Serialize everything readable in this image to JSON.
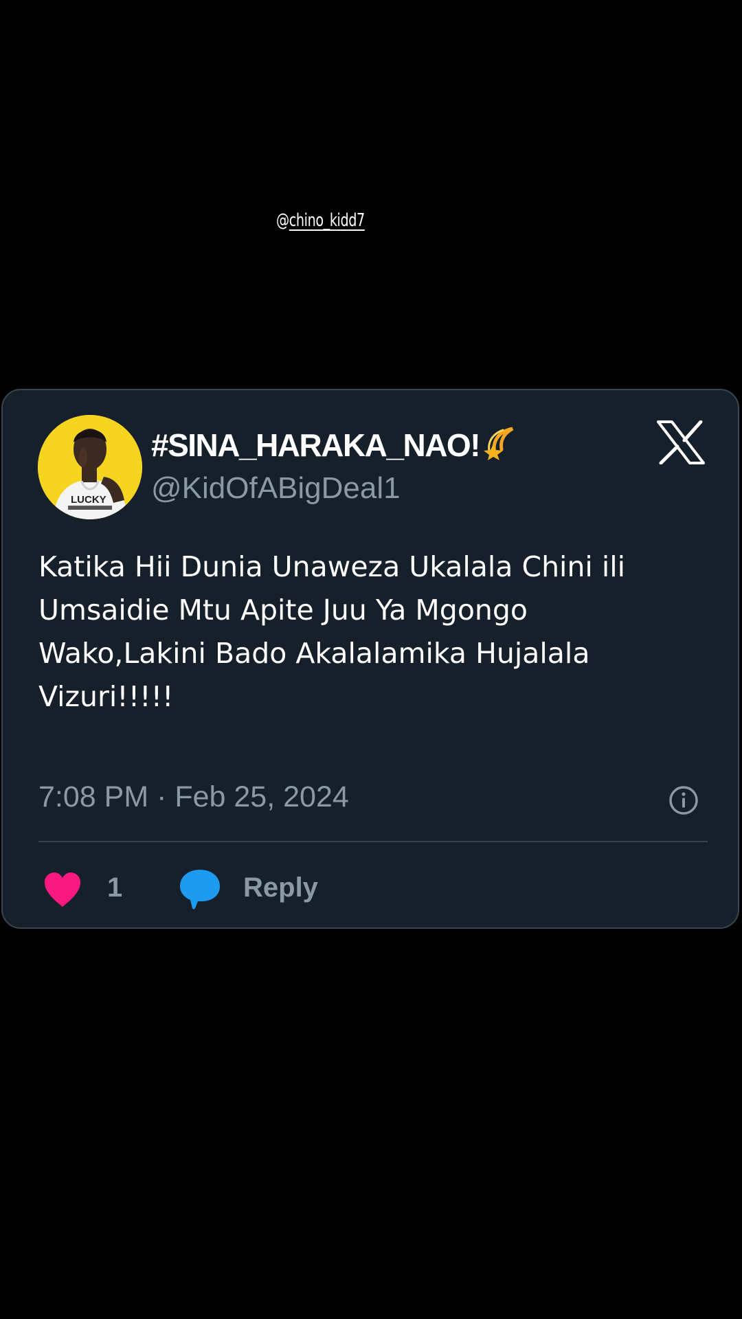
{
  "watermark": {
    "at": "@",
    "handle": "chino_kidd7"
  },
  "tweet": {
    "display_name": "#SINA_HARAKA_NAO!",
    "display_name_emoji": "shooting-star-icon",
    "username": "@KidOfABigDeal1",
    "avatar_text": "LUCKY",
    "text": "Katika Hii Dunia Unaweza Ukalala Chini ili Umsaidie Mtu Apite Juu Ya Mgongo Wako,Lakini Bado Akalalamika Hujalala Vizuri!!!!!",
    "timestamp": "7:08 PM · Feb 25, 2024",
    "like_count": "1",
    "reply_label": "Reply"
  },
  "icons": {
    "brand": "x-logo-icon",
    "info": "info-icon",
    "like": "heart-icon",
    "reply": "speech-bubble-icon"
  },
  "colors": {
    "page_background": "#000000",
    "card_background": "#15202b",
    "card_border": "#3a4550",
    "secondary_text": "#8b98a5",
    "heart": "#f91880",
    "reply_bubble": "#1d9bf0",
    "avatar_background": "#f6d521"
  }
}
